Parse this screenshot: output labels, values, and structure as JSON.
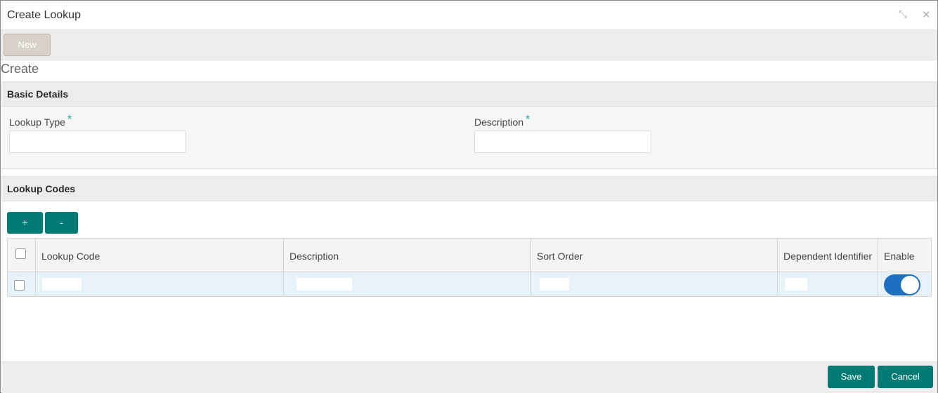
{
  "window": {
    "title": "Create Lookup",
    "minimize_glyph": "⤡",
    "close_glyph": "✕"
  },
  "toolbar": {
    "new_label": "New"
  },
  "mode_label": "Create",
  "basic_details": {
    "title": "Basic Details",
    "lookup_type_label": "Lookup Type",
    "lookup_type_value": "",
    "description_label": "Description",
    "description_value": "",
    "required_mark": "*"
  },
  "lookup_codes": {
    "title": "Lookup Codes",
    "add_label": "+",
    "remove_label": "-",
    "columns": [
      "Lookup Code",
      "Description",
      "Sort Order",
      "Dependent Identifier",
      "Enable"
    ],
    "rows": [
      {
        "lookup_code": "",
        "description": "",
        "sort_order": "",
        "dependent_identifier": "",
        "enabled": true
      }
    ]
  },
  "footer": {
    "save_label": "Save",
    "cancel_label": "Cancel"
  },
  "colors": {
    "accent": "#007a73",
    "toggle_on": "#1f6fc0",
    "required": "#1aa7a0",
    "row_highlight": "#e6f2f8"
  },
  "icons": {
    "minimize": "minimize-icon",
    "close": "close-icon"
  }
}
